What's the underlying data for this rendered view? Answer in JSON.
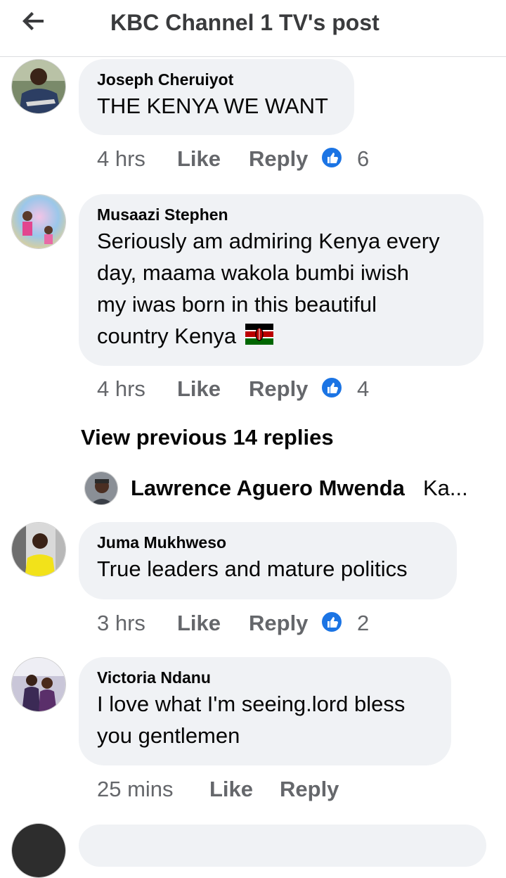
{
  "header": {
    "title": "KBC Channel 1 TV's post",
    "back_icon": "arrow-left-icon"
  },
  "comments": [
    {
      "author": "Joseph Cheruiyot",
      "text": "THE KENYA WE WANT",
      "time": "4 hrs",
      "like_label": "Like",
      "reply_label": "Reply",
      "reaction_count": "6"
    },
    {
      "author": "Musaazi Stephen",
      "text_lines": [
        "Seriously am admiring Kenya every",
        "day, maama wakola bumbi iwish",
        "my iwas born in this beautiful",
        "country Kenya"
      ],
      "emoji": "kenya-flag-icon",
      "time": "4 hrs",
      "like_label": "Like",
      "reply_label": "Reply",
      "reaction_count": "4"
    },
    {
      "author": "Juma Mukhweso",
      "text": "True leaders and mature politics",
      "time": "3 hrs",
      "like_label": "Like",
      "reply_label": "Reply",
      "reaction_count": "2"
    },
    {
      "author": "Victoria Ndanu",
      "text_lines": [
        "I love what I'm seeing.lord bless",
        "you gentlemen"
      ],
      "time": "25 mins",
      "like_label": "Like",
      "reply_label": "Reply"
    }
  ],
  "thread": {
    "view_previous": "View previous 14 replies",
    "reply_preview": {
      "author": "Lawrence Aguero Mwenda",
      "snippet": "Ka..."
    }
  },
  "colors": {
    "accent": "#1b74e4",
    "bubble": "#f0f2f5",
    "secondary_text": "#65676b"
  }
}
